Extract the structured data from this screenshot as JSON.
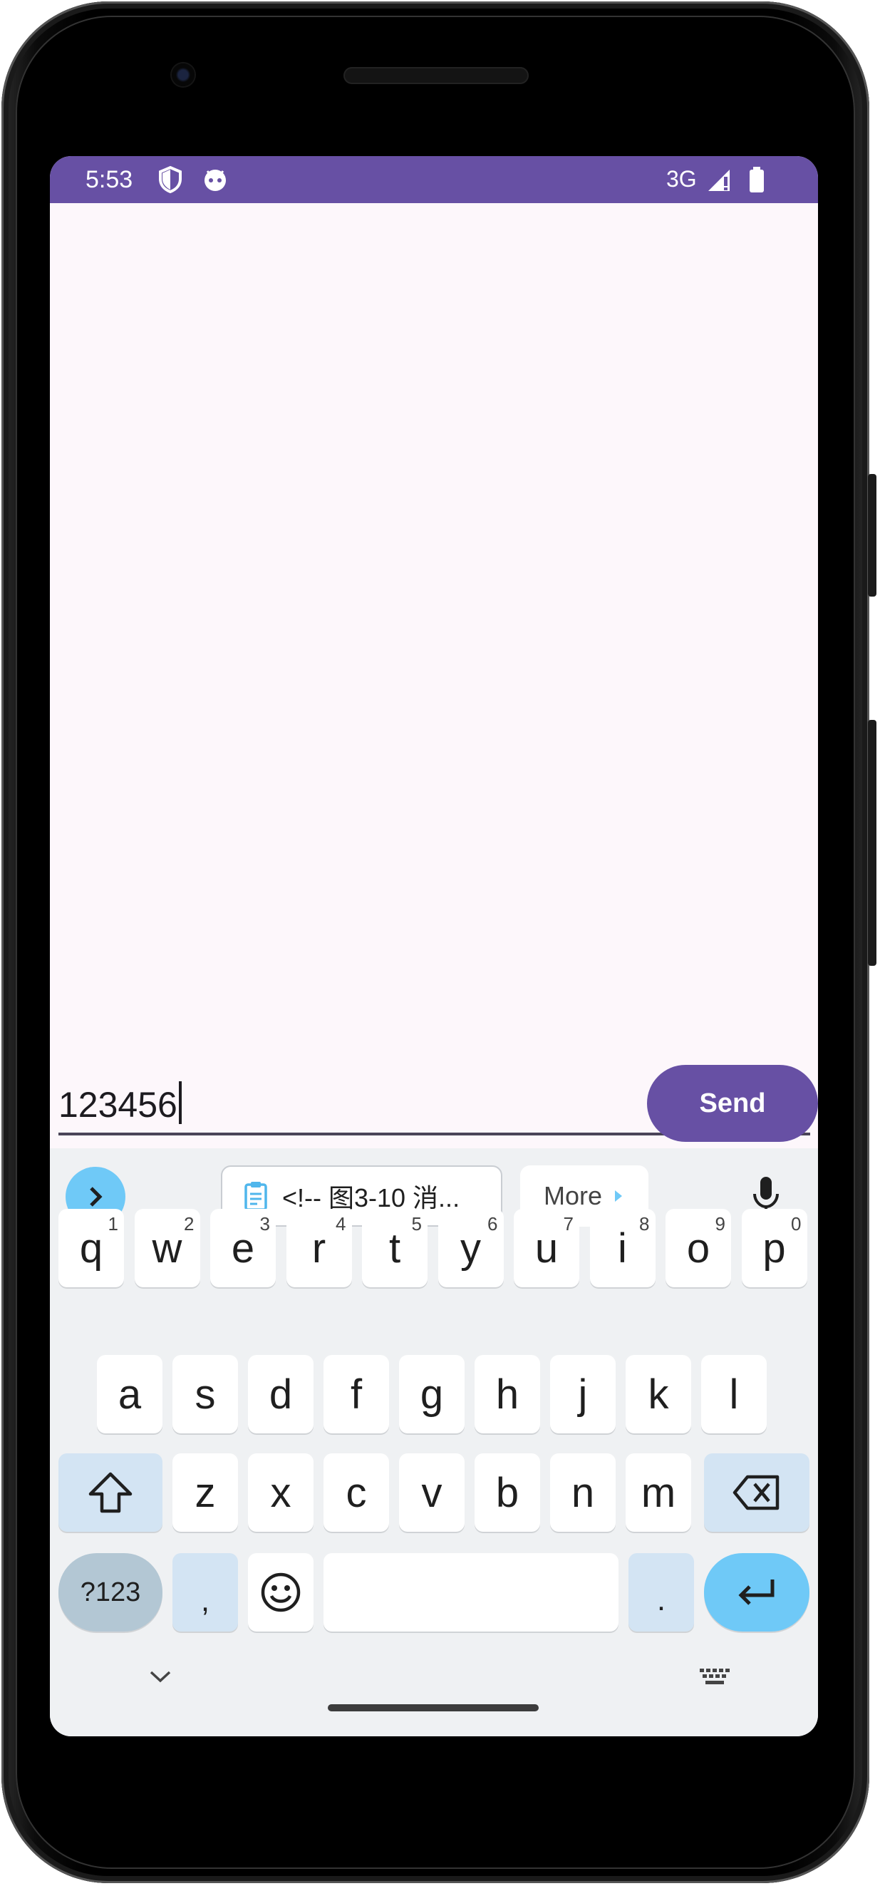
{
  "status_bar": {
    "time": "5:53",
    "network": "3G"
  },
  "message_input": {
    "value": "123456"
  },
  "send_button": {
    "label": "Send"
  },
  "suggestions": {
    "clipboard": "<!-- 图3-10 消...",
    "more": "More"
  },
  "keyboard": {
    "row1": [
      {
        "k": "q",
        "n": "1"
      },
      {
        "k": "w",
        "n": "2"
      },
      {
        "k": "e",
        "n": "3"
      },
      {
        "k": "r",
        "n": "4"
      },
      {
        "k": "t",
        "n": "5"
      },
      {
        "k": "y",
        "n": "6"
      },
      {
        "k": "u",
        "n": "7"
      },
      {
        "k": "i",
        "n": "8"
      },
      {
        "k": "o",
        "n": "9"
      },
      {
        "k": "p",
        "n": "0"
      }
    ],
    "row2": [
      "a",
      "s",
      "d",
      "f",
      "g",
      "h",
      "j",
      "k",
      "l"
    ],
    "row3": [
      "z",
      "x",
      "c",
      "v",
      "b",
      "n",
      "m"
    ],
    "symbols": "?123",
    "comma": ",",
    "period": "."
  },
  "colors": {
    "accent": "#6750a4",
    "key_blue": "#6fc9f7",
    "screen_bg": "#fdf7fb"
  }
}
